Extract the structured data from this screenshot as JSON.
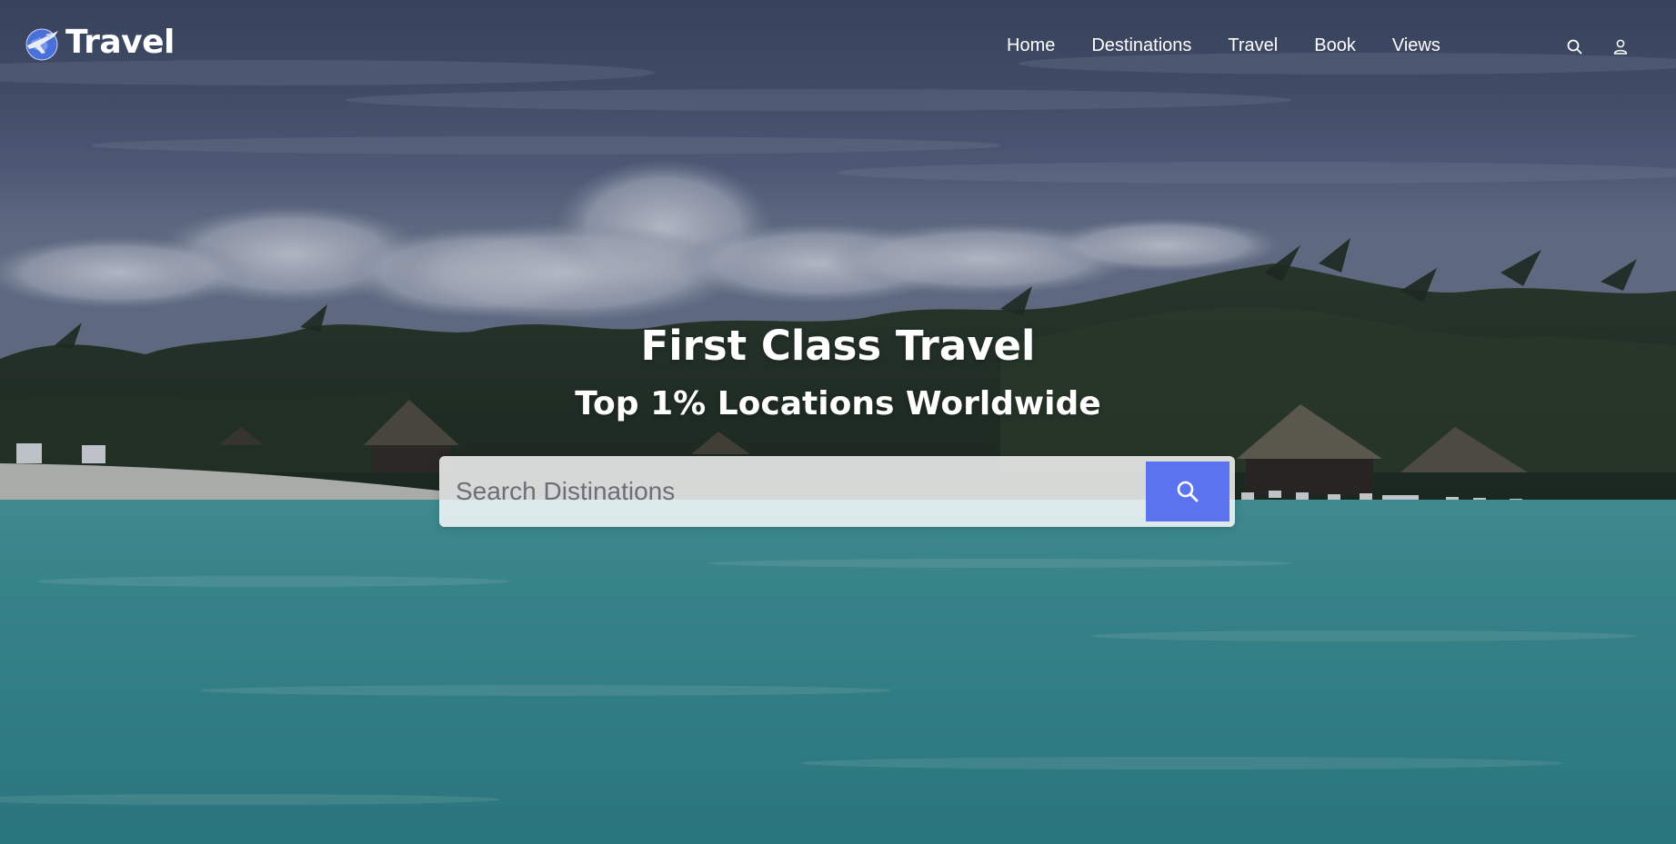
{
  "brand": {
    "name": "Travel",
    "logo_icon": "plane-globe-icon"
  },
  "nav": {
    "items": [
      {
        "label": "Home"
      },
      {
        "label": "Destinations"
      },
      {
        "label": "Travel"
      },
      {
        "label": "Book"
      },
      {
        "label": "Views"
      }
    ],
    "search_icon": "search-icon",
    "user_icon": "user-icon"
  },
  "hero": {
    "title": "First Class Travel",
    "subtitle": "Top 1% Locations Worldwide",
    "background": "tropical-beach-scene"
  },
  "search": {
    "placeholder": "Search Distinations",
    "value": "",
    "button_icon": "search-icon"
  },
  "colors": {
    "accent": "#5b73ee",
    "text_on_hero": "#ffffff"
  }
}
